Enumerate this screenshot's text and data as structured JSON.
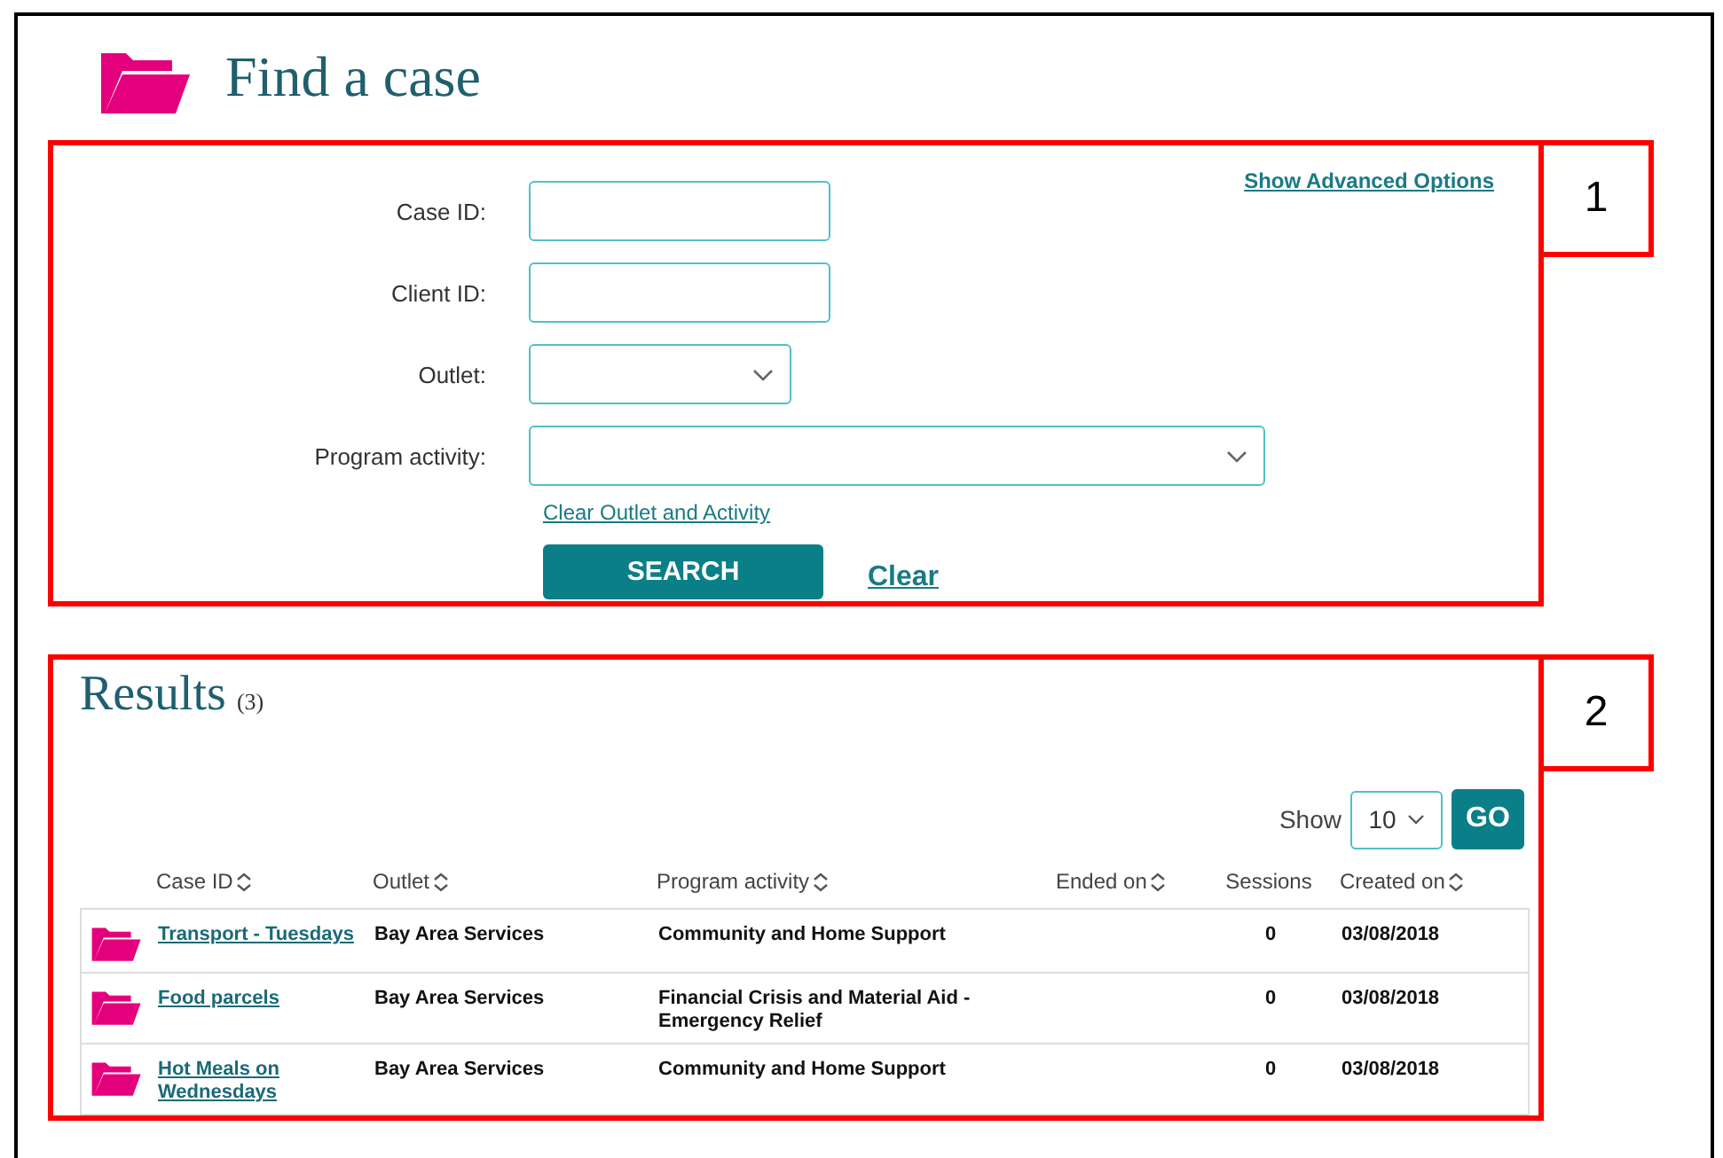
{
  "page": {
    "title": "Find a case"
  },
  "search_panel": {
    "callout": "1",
    "advanced_link": "Show Advanced Options",
    "fields": [
      {
        "label": "Case ID:",
        "kind": "text"
      },
      {
        "label": "Client ID:",
        "kind": "text"
      },
      {
        "label": "Outlet:",
        "kind": "select"
      },
      {
        "label": "Program activity:",
        "kind": "select"
      }
    ],
    "clear_selection_link": "Clear Outlet and Activity",
    "search_button": "SEARCH",
    "clear_link": "Clear"
  },
  "results": {
    "callout": "2",
    "title": "Results",
    "count": "(3)",
    "show_label": "Show",
    "page_size": "10",
    "go_button": "GO",
    "columns": [
      {
        "label": "Case ID",
        "sortable": true
      },
      {
        "label": "Outlet",
        "sortable": true
      },
      {
        "label": "Program activity",
        "sortable": true
      },
      {
        "label": "Ended on",
        "sortable": true
      },
      {
        "label": "Sessions",
        "sortable": false
      },
      {
        "label": "Created on",
        "sortable": true
      }
    ],
    "rows": [
      {
        "case_id": "Transport - Tuesdays",
        "outlet": "Bay Area Services",
        "program_activity": "Community and Home Support",
        "sessions": "0",
        "created_on": "03/08/2018"
      },
      {
        "case_id": "Food parcels",
        "outlet": "Bay Area Services",
        "program_activity": "Financial Crisis and Material Aid - Emergency Relief",
        "sessions": "0",
        "created_on": "03/08/2018"
      },
      {
        "case_id": "Hot Meals on Wednesdays",
        "outlet": "Bay Area Services",
        "program_activity": "Community and Home Support",
        "sessions": "0",
        "created_on": "03/08/2018"
      }
    ]
  }
}
